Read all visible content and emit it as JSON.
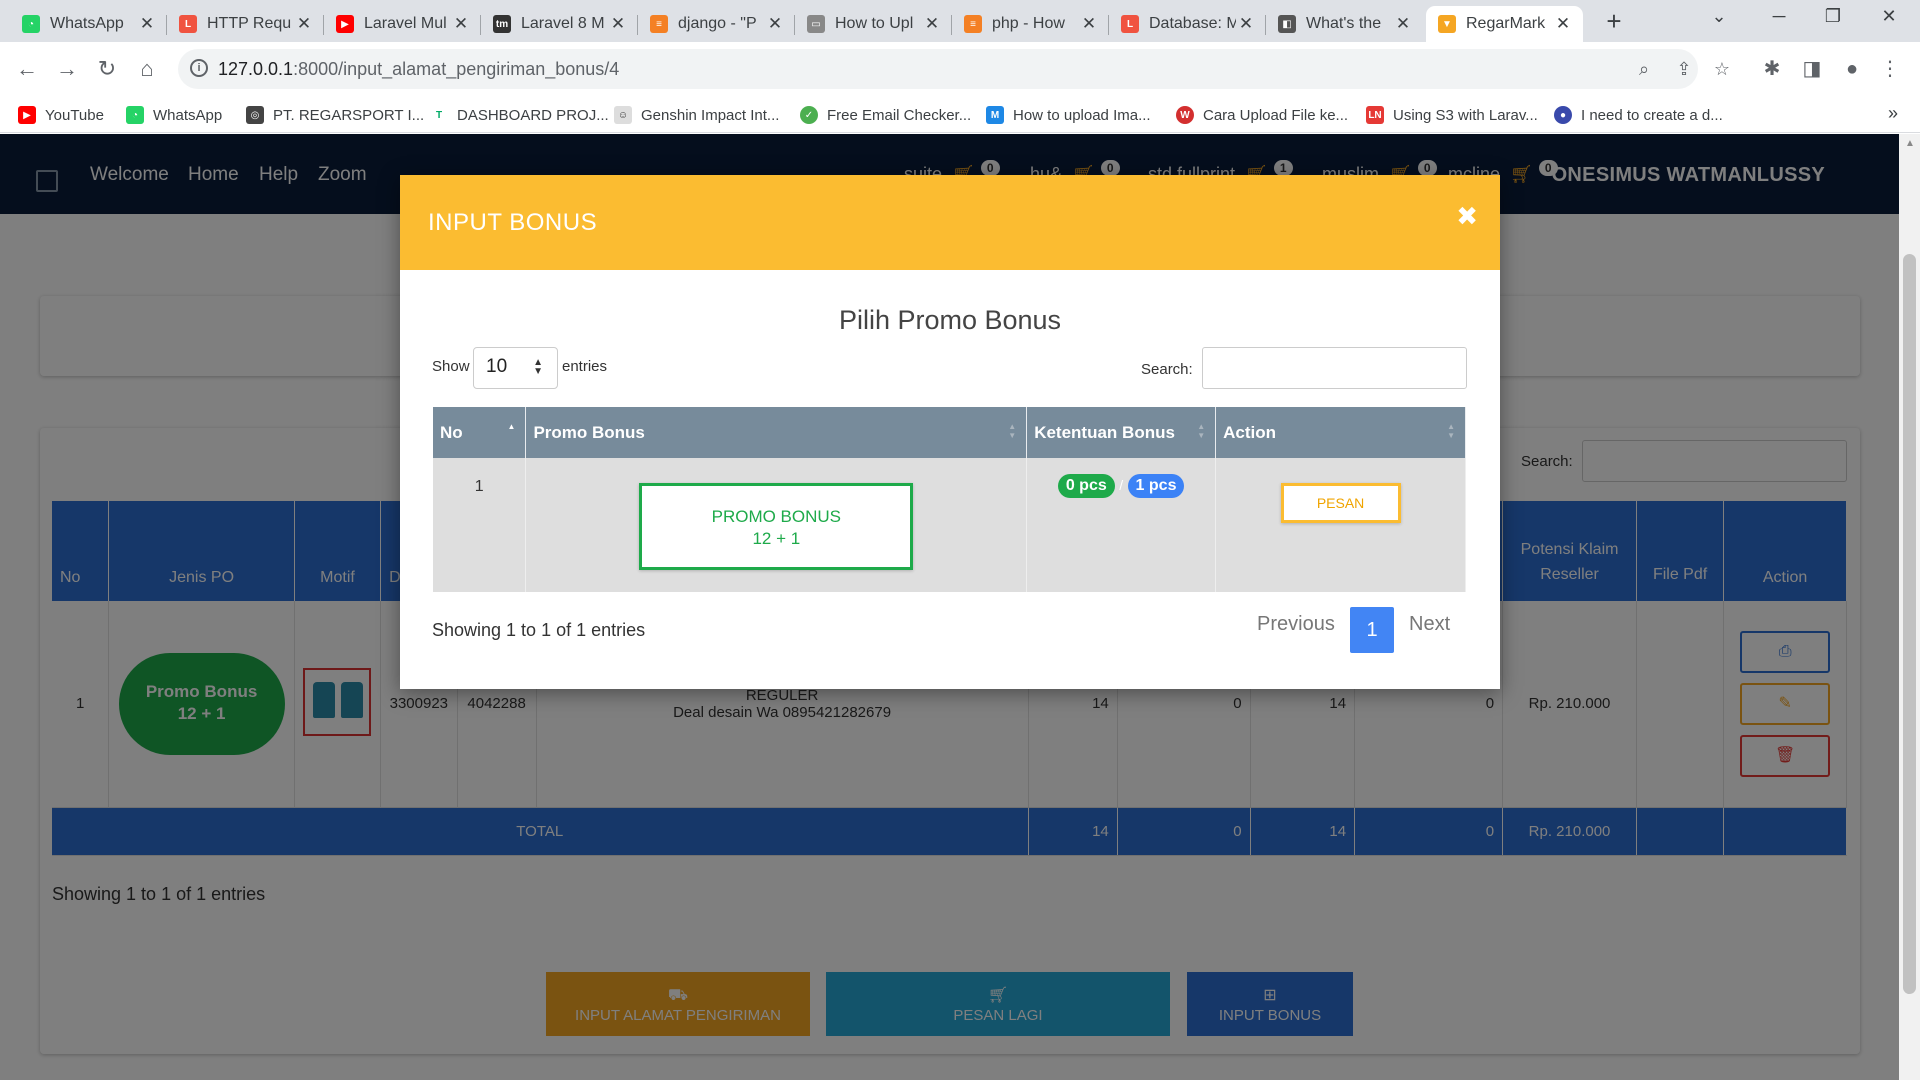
{
  "browser": {
    "tabs": [
      {
        "title": "WhatsApp",
        "color": "#25d366",
        "glyph": "◔"
      },
      {
        "title": "HTTP Requ",
        "color": "#f05340",
        "glyph": "L"
      },
      {
        "title": "Laravel Mul",
        "color": "#ff0000",
        "glyph": "▶"
      },
      {
        "title": "Laravel 8 M",
        "color": "#333333",
        "glyph": "tm"
      },
      {
        "title": "django - \"P",
        "color": "#f48024",
        "glyph": "≡"
      },
      {
        "title": "How to Upl",
        "color": "#888888",
        "glyph": "▭"
      },
      {
        "title": "php - How",
        "color": "#f48024",
        "glyph": "≡"
      },
      {
        "title": "Database: M",
        "color": "#f05340",
        "glyph": "L"
      },
      {
        "title": "What's the",
        "color": "#555555",
        "glyph": "◧"
      },
      {
        "title": "RegarMark",
        "color": "#f5a623",
        "glyph": "▼"
      }
    ],
    "url_host": "127.0.0.1",
    "url_rest": ":8000/input_alamat_pengiriman_bonus/4",
    "bookmarks": [
      {
        "label": "YouTube",
        "color": "#ff0000",
        "glyph": "▶"
      },
      {
        "label": "WhatsApp",
        "color": "#25d366",
        "glyph": "◔"
      },
      {
        "label": "PT. REGARSPORT I...",
        "color": "#444444",
        "glyph": "◎"
      },
      {
        "label": "DASHBOARD PROJ...",
        "color": "#ffffff",
        "glyph": "T"
      },
      {
        "label": "Genshin Impact Int...",
        "color": "#dddddd",
        "glyph": "☺"
      },
      {
        "label": "Free Email Checker...",
        "color": "#4caf50",
        "glyph": "✓"
      },
      {
        "label": "How to upload Ima...",
        "color": "#1e88e5",
        "glyph": "M"
      },
      {
        "label": "Cara Upload File ke...",
        "color": "#d32f2f",
        "glyph": "W"
      },
      {
        "label": "Using S3 with Larav...",
        "color": "#e53935",
        "glyph": "LN"
      },
      {
        "label": "I need to create a d...",
        "color": "#3949ab",
        "glyph": "●"
      }
    ]
  },
  "nav": {
    "links": [
      "Welcome",
      "Home",
      "Help",
      "Zoom"
    ],
    "carts": [
      {
        "label": "suite",
        "count": "0"
      },
      {
        "label": "hu&",
        "count": "0"
      },
      {
        "label": "std fullprint",
        "count": "1"
      },
      {
        "label": "muslim",
        "count": "0"
      },
      {
        "label": "mcline",
        "count": "0"
      }
    ],
    "user": "ONESIMUS WATMANLUSSY"
  },
  "background": {
    "search_label": "Search:",
    "headers": [
      "No",
      "Jenis PO",
      "Motif",
      "D",
      "",
      "",
      "",
      "",
      "",
      "",
      "Potensi Klaim Reseller",
      "File Pdf",
      "Action"
    ],
    "row": {
      "no": "1",
      "jenis_po": "Promo Bonus\n12 + 1",
      "col4": "3300923",
      "col5": "4042288",
      "desc_line1": "REGULER",
      "desc_line2": "Deal desain Wa 0895421282679",
      "n1": "14",
      "n2": "0",
      "n3": "14",
      "n4": "0",
      "potensi": "Rp. 210.000"
    },
    "total": {
      "label": "TOTAL",
      "n1": "14",
      "n2": "0",
      "n3": "14",
      "n4": "0",
      "potensi": "Rp. 210.000"
    },
    "showing": "Showing 1 to 1 of 1 entries",
    "buttons": {
      "alamat": "INPUT ALAMAT PENGIRIMAN",
      "pesan_lagi": "PESAN LAGI",
      "input_bonus": "INPUT BONUS"
    }
  },
  "modal": {
    "title": "INPUT BONUS",
    "subtitle": "Pilih Promo Bonus",
    "show_label": "Show",
    "show_value": "10",
    "entries_label": "entries",
    "search_label": "Search:",
    "columns": [
      "No",
      "Promo Bonus",
      "Ketentuan Bonus",
      "Action"
    ],
    "row": {
      "no": "1",
      "promo_line1": "PROMO BONUS",
      "promo_line2": "12 + 1",
      "badge_green": "0 pcs",
      "badge_sep": "/",
      "badge_blue": "1 pcs",
      "action": "PESAN"
    },
    "showing": "Showing 1 to 1 of 1 entries",
    "pagination": {
      "previous": "Previous",
      "page": "1",
      "next": "Next"
    }
  },
  "colors": {
    "navbar": "#0b1d3a",
    "modal_header": "#fbbc31",
    "table_header_bg": "#2d6fd2",
    "modal_table_header": "#778b9b",
    "green": "#1eaa4a",
    "blue_badge": "#3b82f6"
  }
}
